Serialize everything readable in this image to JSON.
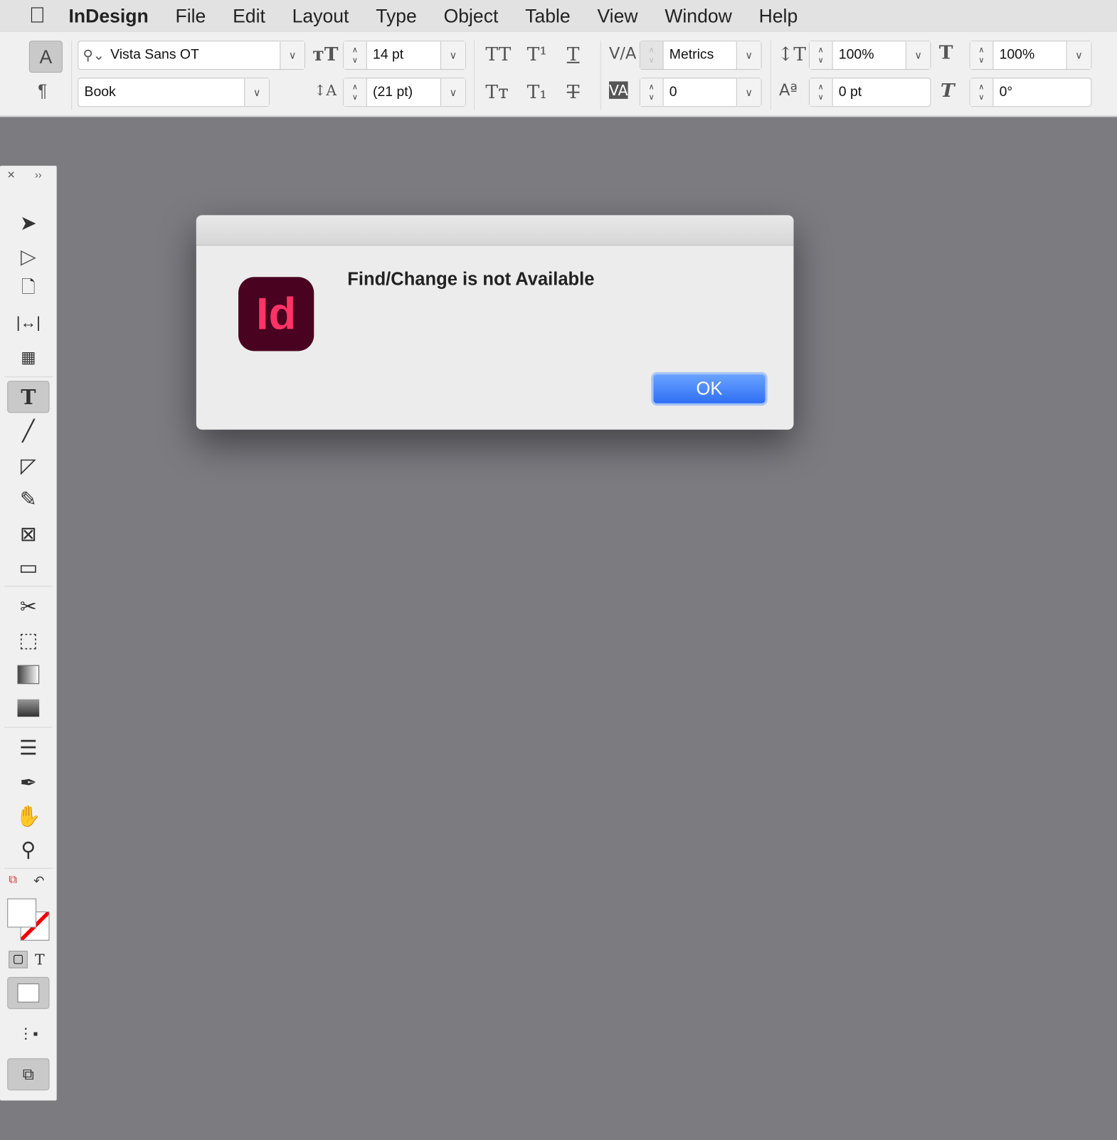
{
  "menubar": {
    "app": "InDesign",
    "items": [
      "File",
      "Edit",
      "Layout",
      "Type",
      "Object",
      "Table",
      "View",
      "Window",
      "Help"
    ]
  },
  "control": {
    "font_family": "Vista Sans OT",
    "font_style": "Book",
    "font_size": "14 pt",
    "leading": "(21 pt)",
    "kerning": "Metrics",
    "tracking": "0",
    "vertical_scale": "100%",
    "horizontal_scale": "100%",
    "baseline_shift": "0 pt",
    "skew": "0°"
  },
  "dialog": {
    "message": "Find/Change is not Available",
    "ok_label": "OK",
    "icon_text": "Id"
  }
}
